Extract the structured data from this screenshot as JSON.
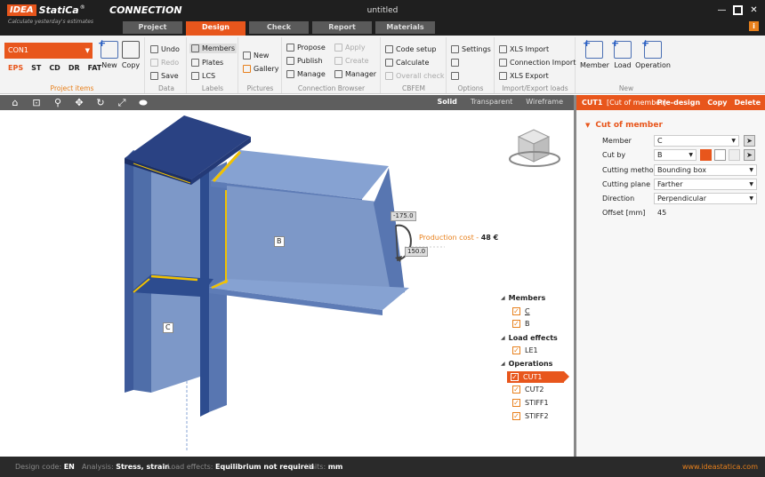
{
  "app": {
    "brand_box": "IDEA",
    "brand_name": "StatiCa",
    "reg": "®",
    "product": "CONNECTION",
    "tagline": "Calculate yesterday's estimates",
    "doc_title": "untitled",
    "info": "i"
  },
  "window_controls": {
    "minimize": "—",
    "maximize": "",
    "close": "✕"
  },
  "tabs": [
    {
      "label": "Project"
    },
    {
      "label": "Design",
      "active": true
    },
    {
      "label": "Check"
    },
    {
      "label": "Report"
    },
    {
      "label": "Materials"
    }
  ],
  "ribbon": {
    "project_items": {
      "selected": "CON1",
      "modes": [
        "EPS",
        "ST",
        "CD",
        "DR",
        "FAT"
      ],
      "new": "New",
      "copy": "Copy",
      "label": "Project items"
    },
    "data": {
      "undo": "Undo",
      "redo": "Redo",
      "save": "Save",
      "label": "Data"
    },
    "labels": {
      "members": "Members",
      "plates": "Plates",
      "lcs": "LCS",
      "label": "Labels"
    },
    "pictures": {
      "new": "New",
      "gallery": "Gallery",
      "label": "Pictures"
    },
    "browser": {
      "propose": "Propose",
      "publish": "Publish",
      "manage": "Manage",
      "apply": "Apply",
      "create": "Create",
      "manager": "Manager",
      "label": "Connection Browser"
    },
    "cbfem": {
      "code_setup": "Code setup",
      "calculate": "Calculate",
      "overall_check": "Overall check",
      "label": "CBFEM"
    },
    "options": {
      "settings": "Settings",
      "label": "Options"
    },
    "import_export": {
      "xls_import": "XLS Import",
      "connection_import": "Connection Import",
      "xls_export": "XLS Export",
      "label": "Import/Export loads"
    },
    "new_group": {
      "member": "Member",
      "load": "Load",
      "operation": "Operation",
      "label": "New"
    }
  },
  "view_modes": [
    "Solid",
    "Transparent",
    "Wireframe"
  ],
  "right_header": {
    "id": "CUT1",
    "desc": "[Cut of member]",
    "actions": [
      "Pre-design",
      "Copy",
      "Delete"
    ]
  },
  "production_cost": {
    "label": "Production cost",
    "sep": "-",
    "value": "48 €"
  },
  "tree": {
    "members": {
      "title": "Members",
      "items": [
        "C",
        "B"
      ]
    },
    "load_effects": {
      "title": "Load effects",
      "items": [
        "LE1"
      ]
    },
    "operations": {
      "title": "Operations",
      "items": [
        "CUT1",
        "CUT2",
        "STIFF1",
        "STIFF2"
      ],
      "selected": "CUT1"
    }
  },
  "scene": {
    "label_b": "B",
    "label_c": "C",
    "dim1": "-175.0",
    "dim2": "150.0"
  },
  "properties": {
    "section": "Cut of member",
    "rows": [
      {
        "label": "Member",
        "value": "C"
      },
      {
        "label": "Cut by",
        "value": "B"
      },
      {
        "label": "Cutting method",
        "value": "Bounding box"
      },
      {
        "label": "Cutting plane",
        "value": "Farther"
      },
      {
        "label": "Direction",
        "value": "Perpendicular"
      },
      {
        "label": "Offset [mm]",
        "value": "45"
      }
    ]
  },
  "status": {
    "design_code_label": "Design code:",
    "design_code": "EN",
    "analysis_label": "Analysis:",
    "analysis": "Stress, strain",
    "load_effects_label": "Load effects:",
    "load_effects": "Equilibrium not required",
    "units_label": "Units:",
    "units": "mm",
    "site": "www.ideastatica.com"
  },
  "colors": {
    "accent": "#e8561c",
    "steel_dark": "#2d4c8f",
    "steel_light": "#8aa6d4",
    "weld": "#f2c200"
  }
}
